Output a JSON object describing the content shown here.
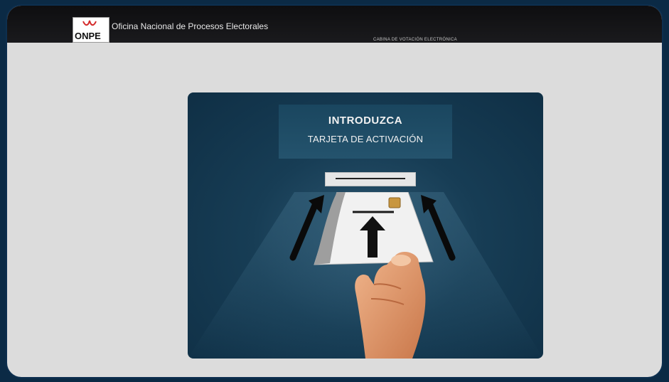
{
  "header": {
    "logo_text": "ONPE",
    "org_name": "Oficina Nacional de Procesos Electorales",
    "subtitle": "CABINA DE VOTACIÓN ELECTRÓNICA"
  },
  "prompt": {
    "line1": "INTRODUZCA",
    "line2": "TARJETA DE ACTIVACIÓN"
  },
  "colors": {
    "page_bg": "#dcdcdc",
    "topbar": "#121214",
    "panel": "#173d55",
    "frame": "#0b2a45"
  },
  "icons": [
    "onpe-logo-icon",
    "card-slot-icon",
    "up-arrow-icon",
    "chip-icon"
  ]
}
